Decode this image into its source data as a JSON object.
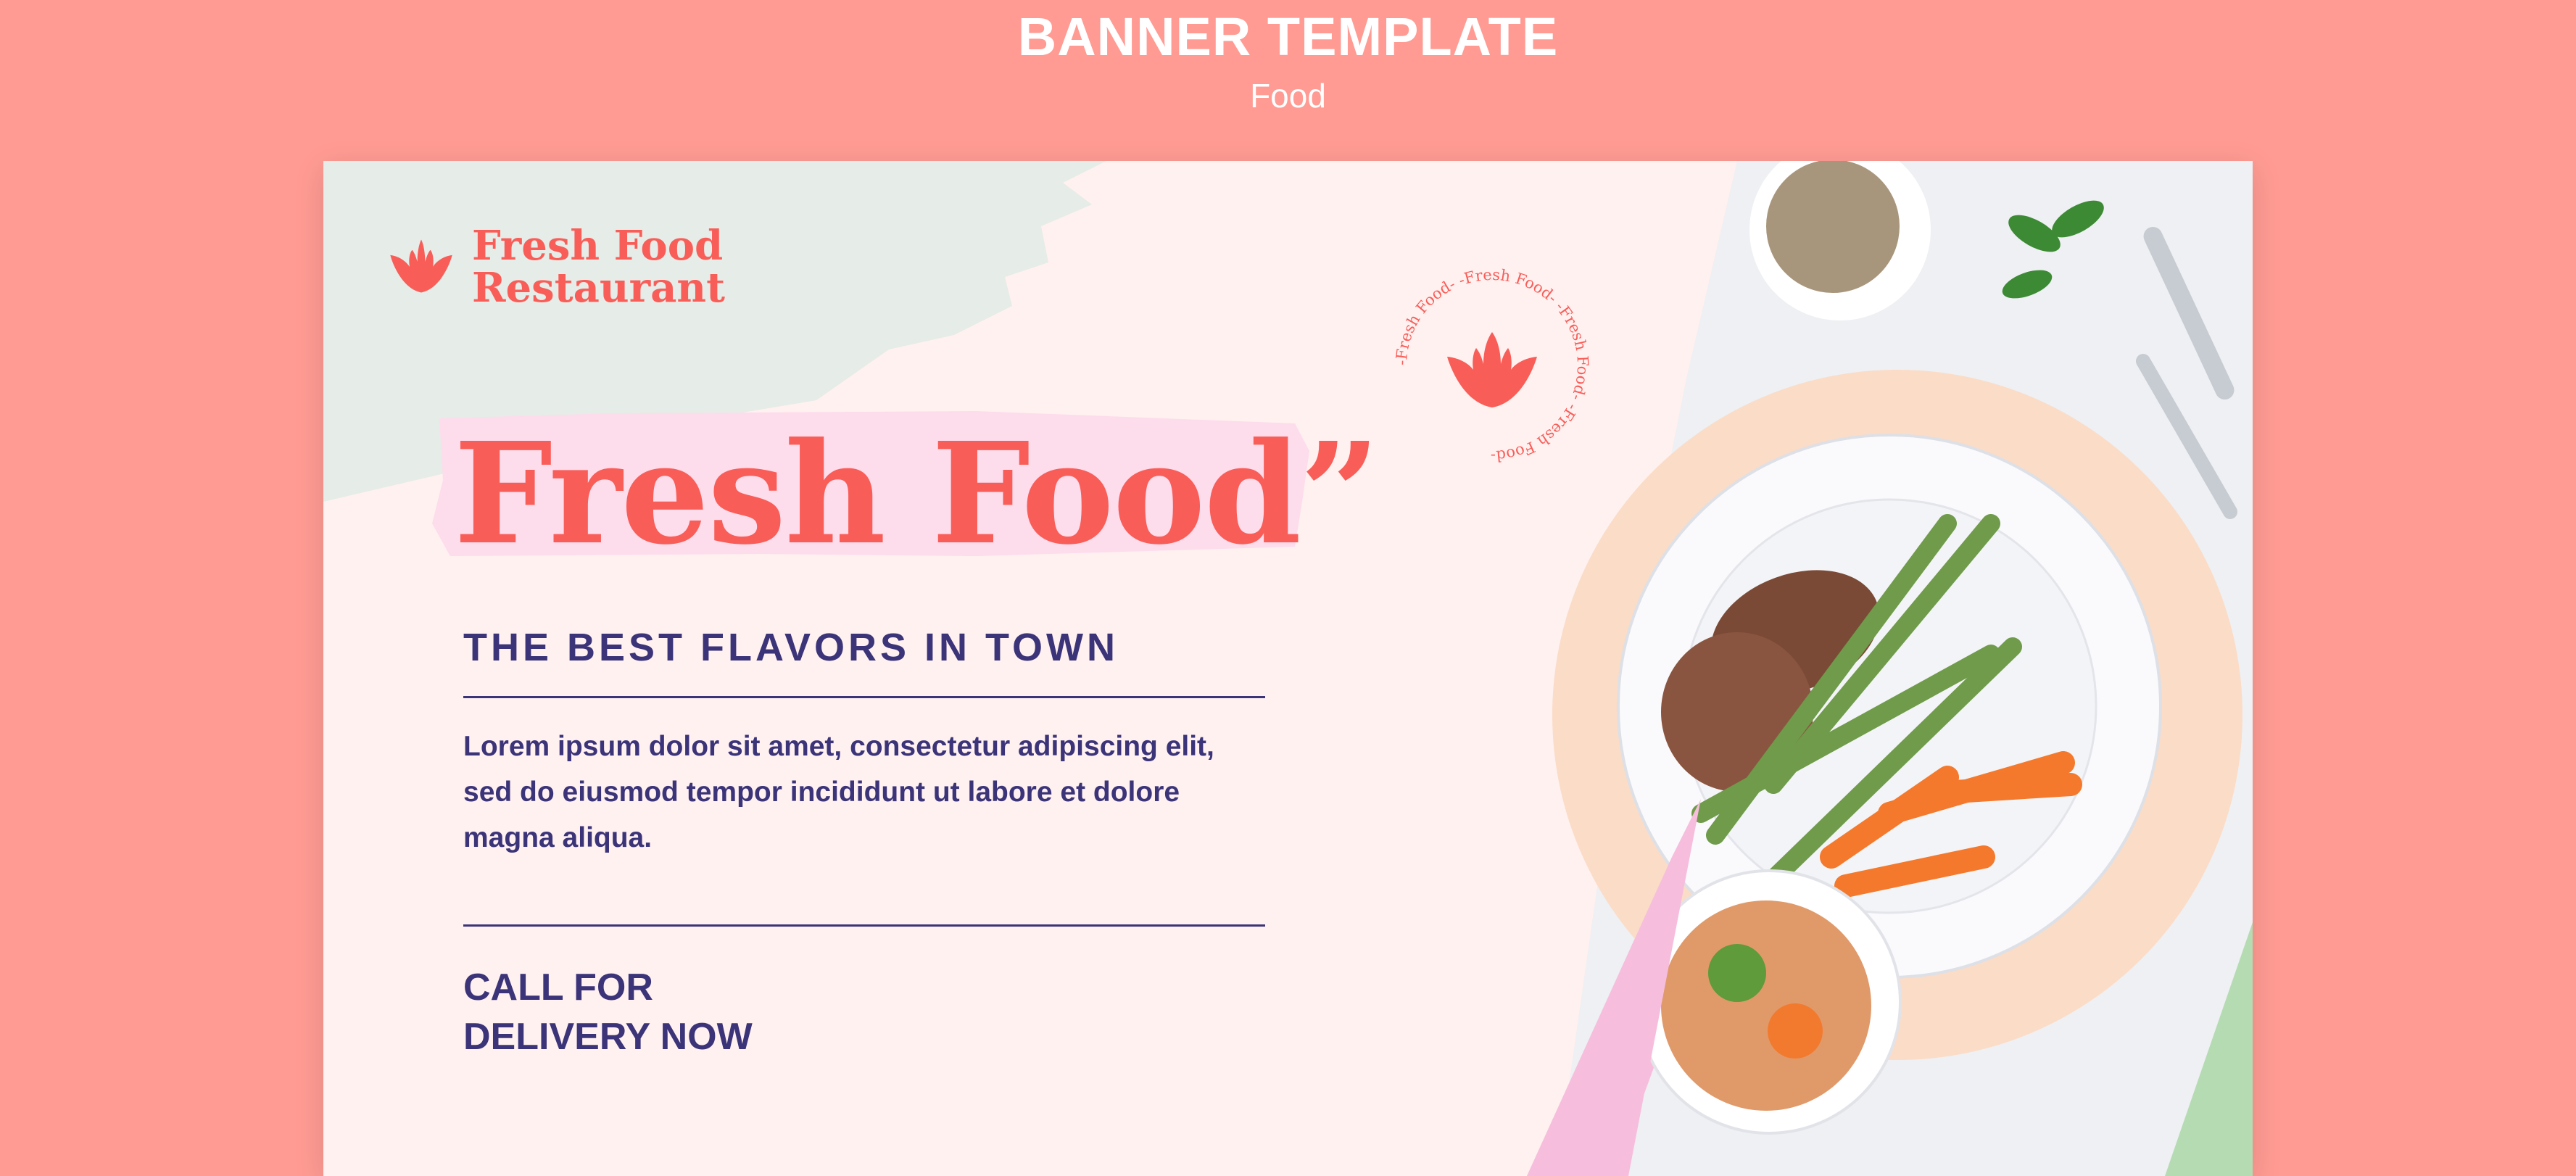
{
  "header": {
    "title": "BANNER TEMPLATE",
    "subtitle": "Food"
  },
  "banner": {
    "logo": {
      "icon": "lotus-icon",
      "line1": "Fresh Food",
      "line2": "Restaurant"
    },
    "headline": "Fresh Food”",
    "tagline": "THE BEST FLAVORS IN TOWN",
    "body_lines": [
      "Lorem ipsum dolor sit amet, consectetur adipiscing elit,",
      "sed do eiusmod tempor incididunt ut labore et dolore",
      "magna aliqua."
    ],
    "cta_line1": "CALL FOR",
    "cta_line2": "DELIVERY NOW",
    "stamp_text": "-Fresh Food- -Fresh Food- -Fresh Food- -Fresh Food-"
  },
  "colors": {
    "background": "#ff9b93",
    "coral": "#f95d58",
    "navy": "#3b3479",
    "card": "#fff1f0",
    "pink_brush": "#fddcec",
    "mint_brush": "#e6ece7"
  }
}
